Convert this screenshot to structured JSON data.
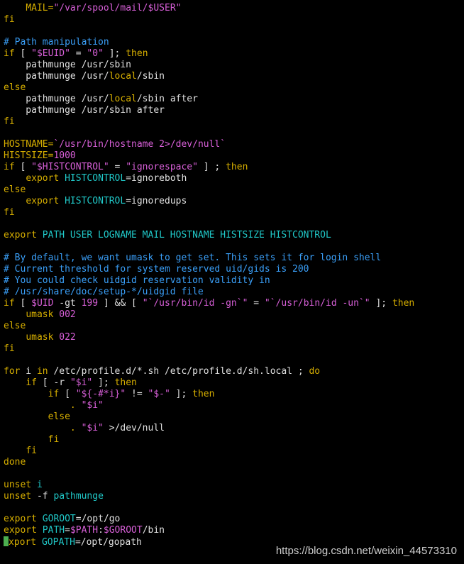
{
  "editor": {
    "lines": [
      [
        {
          "t": "    ",
          "c": "plain"
        },
        {
          "t": "MAIL=",
          "c": "cmd"
        },
        {
          "t": "\"/var/spool/mail/$USER\"",
          "c": "string"
        }
      ],
      [
        {
          "t": "fi",
          "c": "keyword"
        }
      ],
      [
        {
          "t": "",
          "c": "plain"
        }
      ],
      [
        {
          "t": "# Path manipulation",
          "c": "comment"
        }
      ],
      [
        {
          "t": "if",
          "c": "keyword"
        },
        {
          "t": " [ ",
          "c": "plain"
        },
        {
          "t": "\"",
          "c": "string"
        },
        {
          "t": "$EUID",
          "c": "variable"
        },
        {
          "t": "\"",
          "c": "string"
        },
        {
          "t": " = ",
          "c": "plain"
        },
        {
          "t": "\"0\"",
          "c": "string"
        },
        {
          "t": " ]; ",
          "c": "plain"
        },
        {
          "t": "then",
          "c": "keyword"
        }
      ],
      [
        {
          "t": "    pathmunge /usr/sbin",
          "c": "plain"
        }
      ],
      [
        {
          "t": "    pathmunge /usr/",
          "c": "plain"
        },
        {
          "t": "local",
          "c": "path"
        },
        {
          "t": "/sbin",
          "c": "plain"
        }
      ],
      [
        {
          "t": "else",
          "c": "keyword"
        }
      ],
      [
        {
          "t": "    pathmunge /usr/",
          "c": "plain"
        },
        {
          "t": "local",
          "c": "path"
        },
        {
          "t": "/sbin after",
          "c": "plain"
        }
      ],
      [
        {
          "t": "    pathmunge /usr/sbin after",
          "c": "plain"
        }
      ],
      [
        {
          "t": "fi",
          "c": "keyword"
        }
      ],
      [
        {
          "t": "",
          "c": "plain"
        }
      ],
      [
        {
          "t": "HOSTNAME=",
          "c": "cmd"
        },
        {
          "t": "`/usr/bin/hostname 2>/dev/null`",
          "c": "string"
        }
      ],
      [
        {
          "t": "HISTSIZE=",
          "c": "cmd"
        },
        {
          "t": "1000",
          "c": "number"
        }
      ],
      [
        {
          "t": "if",
          "c": "keyword"
        },
        {
          "t": " [ ",
          "c": "plain"
        },
        {
          "t": "\"",
          "c": "string"
        },
        {
          "t": "$HISTCONTROL",
          "c": "variable"
        },
        {
          "t": "\"",
          "c": "string"
        },
        {
          "t": " = ",
          "c": "plain"
        },
        {
          "t": "\"ignorespace\"",
          "c": "string"
        },
        {
          "t": " ] ; ",
          "c": "plain"
        },
        {
          "t": "then",
          "c": "keyword"
        }
      ],
      [
        {
          "t": "    ",
          "c": "plain"
        },
        {
          "t": "export",
          "c": "keyword"
        },
        {
          "t": " ",
          "c": "plain"
        },
        {
          "t": "HISTCONTROL",
          "c": "cyan"
        },
        {
          "t": "=ignoreboth",
          "c": "plain"
        }
      ],
      [
        {
          "t": "else",
          "c": "keyword"
        }
      ],
      [
        {
          "t": "    ",
          "c": "plain"
        },
        {
          "t": "export",
          "c": "keyword"
        },
        {
          "t": " ",
          "c": "plain"
        },
        {
          "t": "HISTCONTROL",
          "c": "cyan"
        },
        {
          "t": "=ignoredups",
          "c": "plain"
        }
      ],
      [
        {
          "t": "fi",
          "c": "keyword"
        }
      ],
      [
        {
          "t": "",
          "c": "plain"
        }
      ],
      [
        {
          "t": "export",
          "c": "keyword"
        },
        {
          "t": " PATH USER LOGNAME MAIL HOSTNAME HISTSIZE HISTCONTROL",
          "c": "cyan"
        }
      ],
      [
        {
          "t": "",
          "c": "plain"
        }
      ],
      [
        {
          "t": "# By default, we want umask to get set. This sets it for login shell",
          "c": "comment"
        }
      ],
      [
        {
          "t": "# Current threshold for system reserved uid/gids is 200",
          "c": "comment"
        }
      ],
      [
        {
          "t": "# You could check uidgid reservation validity in",
          "c": "comment"
        }
      ],
      [
        {
          "t": "# /usr/share/doc/setup-*/uidgid file",
          "c": "comment"
        }
      ],
      [
        {
          "t": "if",
          "c": "keyword"
        },
        {
          "t": " [ ",
          "c": "plain"
        },
        {
          "t": "$UID",
          "c": "variable"
        },
        {
          "t": " -gt ",
          "c": "plain"
        },
        {
          "t": "199",
          "c": "number"
        },
        {
          "t": " ] && [ ",
          "c": "plain"
        },
        {
          "t": "\"`/usr/bin/id -gn`\"",
          "c": "string"
        },
        {
          "t": " = ",
          "c": "plain"
        },
        {
          "t": "\"`/usr/bin/id -un`\"",
          "c": "string"
        },
        {
          "t": " ]; ",
          "c": "plain"
        },
        {
          "t": "then",
          "c": "keyword"
        }
      ],
      [
        {
          "t": "    ",
          "c": "plain"
        },
        {
          "t": "umask",
          "c": "keyword"
        },
        {
          "t": " ",
          "c": "plain"
        },
        {
          "t": "002",
          "c": "number"
        }
      ],
      [
        {
          "t": "else",
          "c": "keyword"
        }
      ],
      [
        {
          "t": "    ",
          "c": "plain"
        },
        {
          "t": "umask",
          "c": "keyword"
        },
        {
          "t": " ",
          "c": "plain"
        },
        {
          "t": "022",
          "c": "number"
        }
      ],
      [
        {
          "t": "fi",
          "c": "keyword"
        }
      ],
      [
        {
          "t": "",
          "c": "plain"
        }
      ],
      [
        {
          "t": "for",
          "c": "keyword"
        },
        {
          "t": " i ",
          "c": "plain"
        },
        {
          "t": "in",
          "c": "keyword"
        },
        {
          "t": " /etc/profile.d/*.sh /etc/profile.d/sh.local ; ",
          "c": "plain"
        },
        {
          "t": "do",
          "c": "keyword"
        }
      ],
      [
        {
          "t": "    ",
          "c": "plain"
        },
        {
          "t": "if",
          "c": "keyword"
        },
        {
          "t": " [ -r ",
          "c": "plain"
        },
        {
          "t": "\"$i\"",
          "c": "string"
        },
        {
          "t": " ]; ",
          "c": "plain"
        },
        {
          "t": "then",
          "c": "keyword"
        }
      ],
      [
        {
          "t": "        ",
          "c": "plain"
        },
        {
          "t": "if",
          "c": "keyword"
        },
        {
          "t": " [ ",
          "c": "plain"
        },
        {
          "t": "\"${-#*i}\"",
          "c": "string"
        },
        {
          "t": " != ",
          "c": "plain"
        },
        {
          "t": "\"$-\"",
          "c": "string"
        },
        {
          "t": " ]; ",
          "c": "plain"
        },
        {
          "t": "then",
          "c": "keyword"
        }
      ],
      [
        {
          "t": "            ",
          "c": "plain"
        },
        {
          "t": ".",
          "c": "keyword"
        },
        {
          "t": " ",
          "c": "plain"
        },
        {
          "t": "\"$i\"",
          "c": "string"
        }
      ],
      [
        {
          "t": "        ",
          "c": "plain"
        },
        {
          "t": "else",
          "c": "keyword"
        }
      ],
      [
        {
          "t": "            ",
          "c": "plain"
        },
        {
          "t": ".",
          "c": "keyword"
        },
        {
          "t": " ",
          "c": "plain"
        },
        {
          "t": "\"$i\"",
          "c": "string"
        },
        {
          "t": " >/dev/null",
          "c": "plain"
        }
      ],
      [
        {
          "t": "        ",
          "c": "plain"
        },
        {
          "t": "fi",
          "c": "keyword"
        }
      ],
      [
        {
          "t": "    ",
          "c": "plain"
        },
        {
          "t": "fi",
          "c": "keyword"
        }
      ],
      [
        {
          "t": "done",
          "c": "keyword"
        }
      ],
      [
        {
          "t": "",
          "c": "plain"
        }
      ],
      [
        {
          "t": "unset",
          "c": "keyword"
        },
        {
          "t": " i",
          "c": "cyan"
        }
      ],
      [
        {
          "t": "unset",
          "c": "keyword"
        },
        {
          "t": " -f ",
          "c": "plain"
        },
        {
          "t": "pathmunge",
          "c": "cyan"
        }
      ],
      [
        {
          "t": "",
          "c": "plain"
        }
      ],
      [
        {
          "t": "export",
          "c": "keyword"
        },
        {
          "t": " GOROOT",
          "c": "cyan"
        },
        {
          "t": "=/opt/go",
          "c": "plain"
        }
      ],
      [
        {
          "t": "export",
          "c": "keyword"
        },
        {
          "t": " PATH",
          "c": "cyan"
        },
        {
          "t": "=",
          "c": "plain"
        },
        {
          "t": "$PATH",
          "c": "variable"
        },
        {
          "t": ":",
          "c": "plain"
        },
        {
          "t": "$GOROOT",
          "c": "variable"
        },
        {
          "t": "/bin",
          "c": "plain"
        }
      ],
      [
        {
          "t": "CURSOR",
          "c": "cursor"
        },
        {
          "t": "xport",
          "c": "keyword"
        },
        {
          "t": " GOPATH",
          "c": "cyan"
        },
        {
          "t": "=/opt/gopath",
          "c": "plain"
        }
      ]
    ]
  },
  "watermark": "https://blog.csdn.net/weixin_44573310",
  "colors": {
    "background": "#000000",
    "plain": "#e0e0e0",
    "keyword": "#d7af00",
    "string": "#d75fd7",
    "comment": "#3a9ff8",
    "cyan": "#20c8c8",
    "cursor": "#4caf50"
  }
}
